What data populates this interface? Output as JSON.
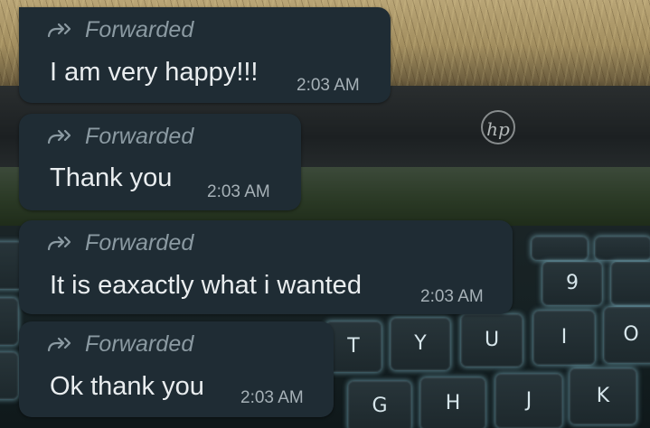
{
  "background": {
    "laptop_logo_text": "hp",
    "keys": [
      "T",
      "Y",
      "U",
      "I",
      "O",
      "G",
      "H",
      "J",
      "K",
      "9"
    ]
  },
  "colors": {
    "bubble": "#1f2c34",
    "message_text": "#e9edef",
    "forwarded_label": "#8b9aa2",
    "timestamp": "#a6b1b7"
  },
  "messages": [
    {
      "forwarded_icon": "forward-arrow-icon",
      "forwarded_label": "Forwarded",
      "text": "I am very happy!!!",
      "time": "2:03 AM"
    },
    {
      "forwarded_icon": "forward-arrow-icon",
      "forwarded_label": "Forwarded",
      "text": "Thank you",
      "time": "2:03 AM"
    },
    {
      "forwarded_icon": "forward-arrow-icon",
      "forwarded_label": "Forwarded",
      "text": "It is eaxactly what i wanted",
      "time": "2:03 AM"
    },
    {
      "forwarded_icon": "forward-arrow-icon",
      "forwarded_label": "Forwarded",
      "text": "Ok thank you",
      "time": "2:03 AM"
    }
  ]
}
